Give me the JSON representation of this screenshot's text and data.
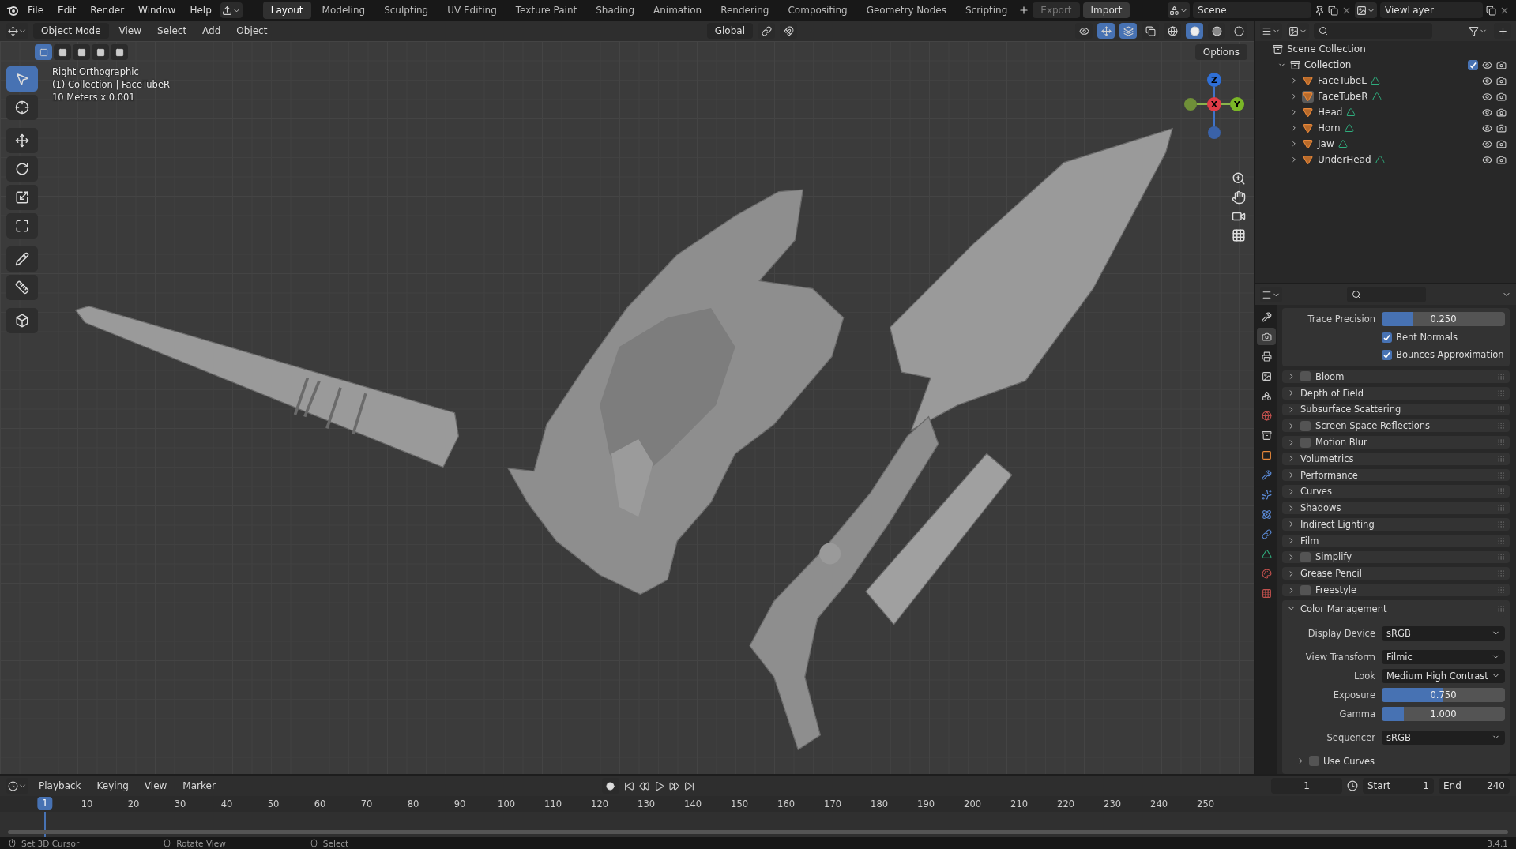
{
  "topbar": {
    "menus": [
      "File",
      "Edit",
      "Render",
      "Window",
      "Help"
    ],
    "workspaces": [
      {
        "label": "Layout",
        "selected": true
      },
      {
        "label": "Modeling",
        "selected": false
      },
      {
        "label": "Sculpting",
        "selected": false
      },
      {
        "label": "UV Editing",
        "selected": false
      },
      {
        "label": "Texture Paint",
        "selected": false
      },
      {
        "label": "Shading",
        "selected": false
      },
      {
        "label": "Animation",
        "selected": false
      },
      {
        "label": "Rendering",
        "selected": false
      },
      {
        "label": "Compositing",
        "selected": false
      },
      {
        "label": "Geometry Nodes",
        "selected": false
      },
      {
        "label": "Scripting",
        "selected": false
      }
    ],
    "export": "Export",
    "import": "Import",
    "scene": "Scene",
    "view_layer": "ViewLayer"
  },
  "viewport": {
    "mode": "Object Mode",
    "menus": [
      "View",
      "Select",
      "Add",
      "Object"
    ],
    "orientation": "Global",
    "options": "Options",
    "overlay_lines": [
      "Right Orthographic",
      "(1) Collection | FaceTubeR",
      "10 Meters x 0.001"
    ],
    "select_modes": [
      {
        "kind": "set",
        "selected": true
      },
      {
        "kind": "extend",
        "selected": false
      },
      {
        "kind": "subtract",
        "selected": false
      },
      {
        "kind": "invert",
        "selected": false
      },
      {
        "kind": "intersect",
        "selected": false
      }
    ],
    "tools": [
      {
        "kind": "select",
        "selected": true
      },
      {
        "kind": "cursor",
        "selected": false
      },
      {
        "kind": "move",
        "selected": false
      },
      {
        "kind": "rotate",
        "selected": false
      },
      {
        "kind": "scale",
        "selected": false
      },
      {
        "kind": "transform",
        "selected": false
      },
      {
        "kind": "annotate",
        "selected": false
      },
      {
        "kind": "measure",
        "selected": false
      },
      {
        "kind": "add_cube",
        "selected": false
      }
    ],
    "shading_modes": [
      {
        "kind": "wireframe",
        "selected": false
      },
      {
        "kind": "solid",
        "selected": true
      },
      {
        "kind": "material",
        "selected": false
      },
      {
        "kind": "rendered",
        "selected": false
      }
    ],
    "gizmo": [
      {
        "label": "Z",
        "color": "#2f6fd6"
      },
      {
        "label": "X",
        "color": "#e03c47"
      },
      {
        "label": "Y",
        "color": "#7ab627"
      }
    ]
  },
  "outliner": {
    "root": "Scene Collection",
    "collection": {
      "name": "Collection",
      "expanded": true,
      "checked": true,
      "children": [
        {
          "name": "FaceTubeL",
          "selected": false
        },
        {
          "name": "FaceTubeR",
          "selected": true
        },
        {
          "name": "Head",
          "selected": false
        },
        {
          "name": "Horn",
          "selected": false
        },
        {
          "name": "Jaw",
          "selected": false
        },
        {
          "name": "UnderHead",
          "selected": false
        }
      ]
    }
  },
  "properties": {
    "tabs": [
      {
        "kind": "tool",
        "selected": false
      },
      {
        "kind": "render",
        "selected": true
      },
      {
        "kind": "output",
        "selected": false
      },
      {
        "kind": "view_layer",
        "selected": false
      },
      {
        "kind": "scene",
        "selected": false
      },
      {
        "kind": "world",
        "selected": false
      },
      {
        "kind": "collection",
        "selected": false
      },
      {
        "kind": "object",
        "selected": false
      },
      {
        "kind": "modifiers",
        "selected": false
      },
      {
        "kind": "particles",
        "selected": false
      },
      {
        "kind": "physics",
        "selected": false
      },
      {
        "kind": "constraints",
        "selected": false
      },
      {
        "kind": "data",
        "selected": false
      },
      {
        "kind": "material",
        "selected": false
      },
      {
        "kind": "texture",
        "selected": false
      }
    ],
    "trace_precision": {
      "label": "Trace Precision",
      "value": "0.250",
      "level": 0.25
    },
    "checks": [
      {
        "label": "Bent Normals",
        "checked": true
      },
      {
        "label": "Bounces Approximation",
        "checked": true
      }
    ],
    "panels": [
      {
        "kind": "toggle",
        "label": "Bloom",
        "checked": false
      },
      {
        "kind": "plain",
        "label": "Depth of Field"
      },
      {
        "kind": "plain",
        "label": "Subsurface Scattering"
      },
      {
        "kind": "toggle",
        "label": "Screen Space Reflections",
        "checked": false
      },
      {
        "kind": "toggle",
        "label": "Motion Blur",
        "checked": false
      },
      {
        "kind": "plain",
        "label": "Volumetrics"
      },
      {
        "kind": "plain",
        "label": "Performance"
      },
      {
        "kind": "plain",
        "label": "Curves"
      },
      {
        "kind": "plain",
        "label": "Shadows"
      },
      {
        "kind": "plain",
        "label": "Indirect Lighting"
      },
      {
        "kind": "plain",
        "label": "Film"
      },
      {
        "kind": "toggle",
        "label": "Simplify",
        "checked": false
      },
      {
        "kind": "plain",
        "label": "Grease Pencil"
      },
      {
        "kind": "toggle",
        "label": "Freestyle",
        "checked": false
      }
    ],
    "color_management": {
      "label": "Color Management",
      "expanded": true,
      "rows": [
        {
          "kind": "dropdown",
          "label": "Display Device",
          "value": "sRGB"
        },
        {
          "kind": "dropdown",
          "label": "View Transform",
          "value": "Filmic"
        },
        {
          "kind": "dropdown",
          "label": "Look",
          "value": "Medium High Contrast"
        },
        {
          "kind": "slider",
          "label": "Exposure",
          "value": "0.750",
          "level": 0.5
        },
        {
          "kind": "slider",
          "label": "Gamma",
          "value": "1.000",
          "level": 0.18
        },
        {
          "kind": "dropdown",
          "label": "Sequencer",
          "value": "sRGB"
        }
      ],
      "use_curves": {
        "label": "Use Curves",
        "checked": false
      }
    }
  },
  "timeline": {
    "menus": [
      "Playback",
      "Keying",
      "View",
      "Marker"
    ],
    "current_frame": "1",
    "start_label": "Start",
    "start": "1",
    "end_label": "End",
    "end": "240",
    "playhead": "1",
    "ticks": [
      "10",
      "20",
      "30",
      "40",
      "50",
      "60",
      "70",
      "80",
      "90",
      "100",
      "110",
      "120",
      "130",
      "140",
      "150",
      "160",
      "170",
      "180",
      "190",
      "200",
      "210",
      "220",
      "230",
      "240",
      "250"
    ]
  },
  "status_bar": {
    "hints": [
      "Set 3D Cursor",
      "Rotate View",
      "Select"
    ],
    "version": "3.4.1"
  }
}
